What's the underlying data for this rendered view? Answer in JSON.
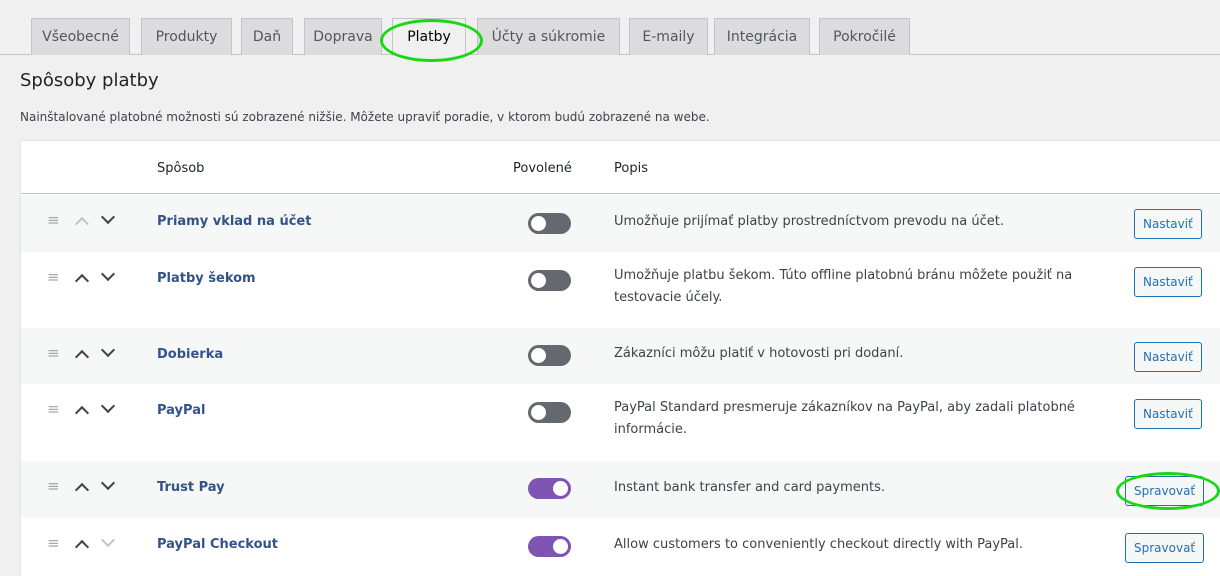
{
  "tabs": [
    {
      "label": "Všeobecné"
    },
    {
      "label": "Produkty"
    },
    {
      "label": "Daň"
    },
    {
      "label": "Doprava"
    },
    {
      "label": "Platby",
      "active": true
    },
    {
      "label": "Účty a súkromie"
    },
    {
      "label": "E-maily"
    },
    {
      "label": "Integrácia"
    },
    {
      "label": "Pokročilé"
    }
  ],
  "page": {
    "title": "Spôsoby platby",
    "intro": "Nainštalované platobné možnosti sú zobrazené nižšie. Môžete upraviť poradie, v ktorom budú zobrazené na webe."
  },
  "table": {
    "headers": {
      "method": "Spôsob",
      "enabled": "Povolené",
      "description": "Popis"
    },
    "rows": [
      {
        "name": "Priamy vklad na účet",
        "enabled": false,
        "description": "Umožňuje prijímať platby prostredníctvom prevodu na účet.",
        "action": "Nastaviť",
        "up_disabled": true,
        "down_disabled": false
      },
      {
        "name": "Platby šekom",
        "enabled": false,
        "description": "Umožňuje platbu šekom. Túto offline platobnú bránu môžete použiť na testovacie účely.",
        "action": "Nastaviť",
        "up_disabled": false,
        "down_disabled": false
      },
      {
        "name": "Dobierka",
        "enabled": false,
        "description": "Zákazníci môžu platiť v hotovosti pri dodaní.",
        "action": "Nastaviť",
        "up_disabled": false,
        "down_disabled": false
      },
      {
        "name": "PayPal",
        "enabled": false,
        "description": "PayPal Standard presmeruje zákazníkov na PayPal, aby zadali platobné informácie.",
        "action": "Nastaviť",
        "up_disabled": false,
        "down_disabled": false
      },
      {
        "name": "Trust Pay",
        "enabled": true,
        "description": "Instant bank transfer and card payments.",
        "action": "Spravovať",
        "up_disabled": false,
        "down_disabled": false
      },
      {
        "name": "PayPal Checkout",
        "enabled": true,
        "description": "Allow customers to conveniently checkout directly with PayPal.",
        "action": "Spravovať",
        "up_disabled": false,
        "down_disabled": true
      }
    ]
  },
  "colors": {
    "highlight": "#18d911",
    "toggle_on": "#7f54b3",
    "toggle_off": "#646970",
    "button": "#2271b1"
  }
}
